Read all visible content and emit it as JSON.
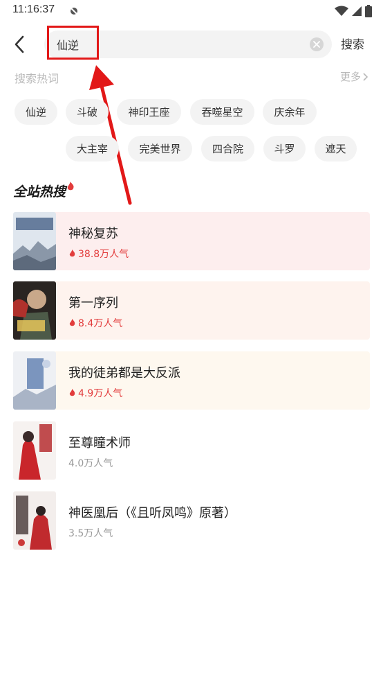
{
  "status_bar": {
    "time": "11:16:37"
  },
  "search": {
    "placeholder": "",
    "value": "仙逆",
    "submit_label": "搜索"
  },
  "hot_words": {
    "title": "搜索热词",
    "more_label": "更多",
    "tags": [
      "仙逆",
      "斗破",
      "神印王座",
      "吞噬星空",
      "庆余年",
      "大主宰",
      "完美世界",
      "四合院",
      "斗罗",
      "遮天"
    ]
  },
  "ranking": {
    "title": "全站热搜",
    "books": [
      {
        "title": "神秘复苏",
        "popularity": "38.8万人气",
        "hot": true
      },
      {
        "title": "第一序列",
        "popularity": "8.4万人气",
        "hot": true
      },
      {
        "title": "我的徒弟都是大反派",
        "popularity": "4.9万人气",
        "hot": true
      },
      {
        "title": "至尊瞳术师",
        "popularity": "4.0万人气",
        "hot": false
      },
      {
        "title": "神医凰后（《且听凤鸣》原著）",
        "popularity": "3.5万人气",
        "hot": false
      }
    ]
  },
  "colors": {
    "accent": "#e23c3c",
    "annotation": "#e21818"
  }
}
